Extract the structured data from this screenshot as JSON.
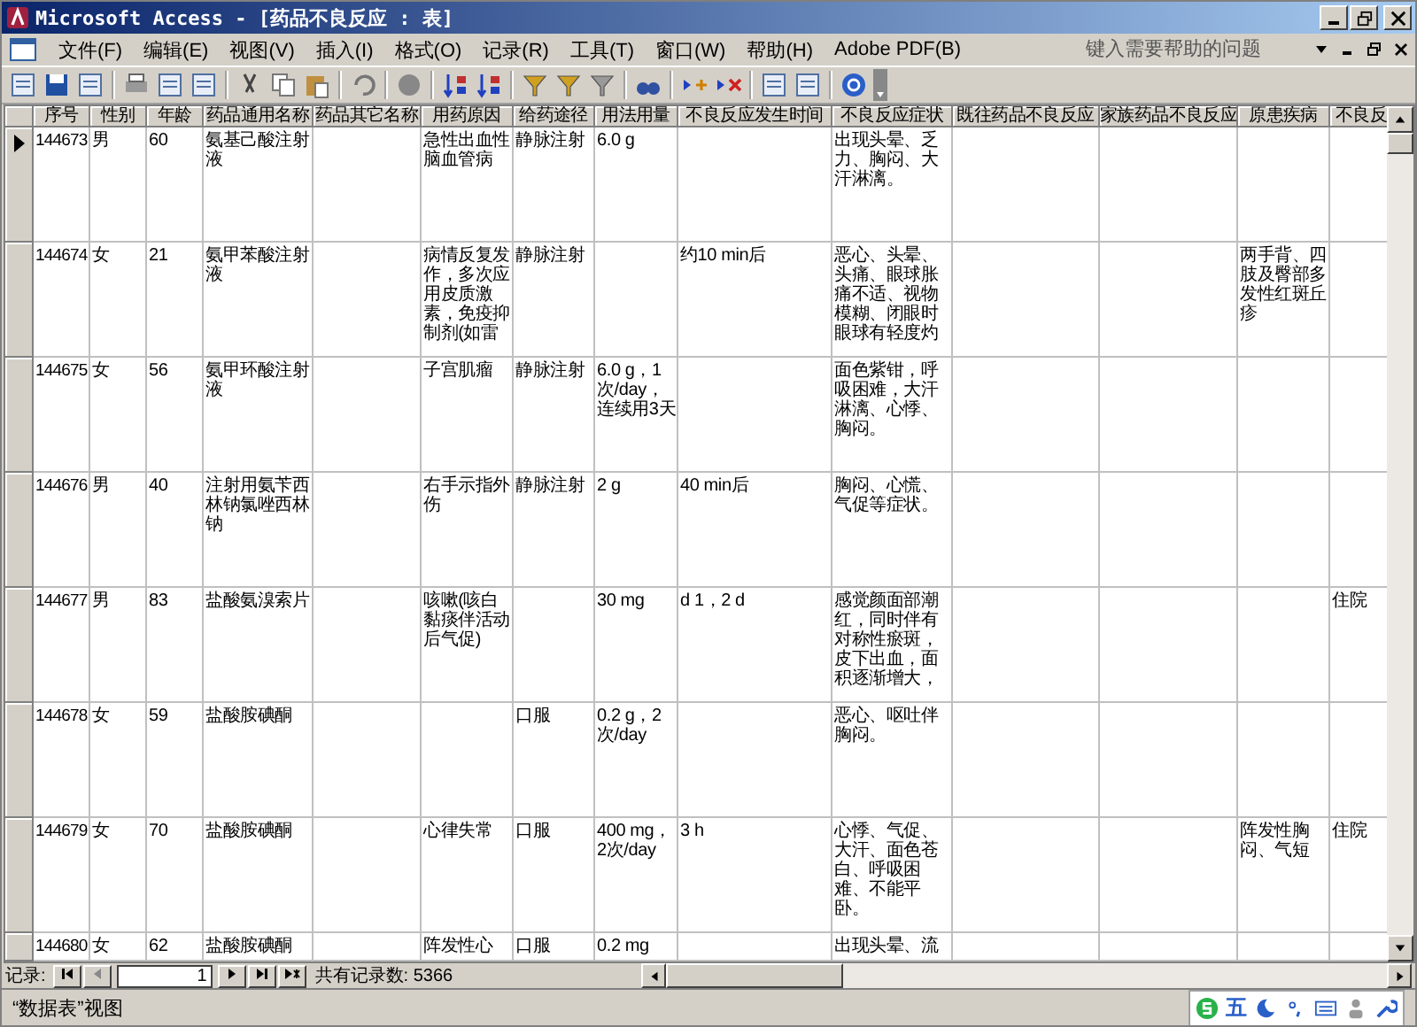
{
  "window": {
    "title": "Microsoft Access - [药品不良反应 : 表]"
  },
  "menu": [
    "文件(F)",
    "编辑(E)",
    "视图(V)",
    "插入(I)",
    "格式(O)",
    "记录(R)",
    "工具(T)",
    "窗口(W)",
    "帮助(H)",
    "Adobe PDF(B)"
  ],
  "help_search": {
    "placeholder": "键入需要帮助的问题"
  },
  "table": {
    "columns": [
      "序号",
      "性别",
      "年龄",
      "药品通用名称",
      "药品其它名称",
      "用药原因",
      "给药途径",
      "用法用量",
      "不良反应发生时间",
      "不良反应症状",
      "既往药品不良反应",
      "家族药品不良反应",
      "原患疾病",
      "不良反"
    ],
    "rows": [
      {
        "selected": true,
        "id": "144673",
        "sex": "男",
        "age": "60",
        "generic_name": "氨基己酸注射液",
        "reason": "急性出血性脑血管病",
        "route": "静脉注射",
        "dosage": "6.0 g",
        "symptoms": "出现头晕、乏力、胸闷、大汗淋漓。"
      },
      {
        "selected": false,
        "id": "144674",
        "sex": "女",
        "age": "21",
        "generic_name": "氨甲苯酸注射液",
        "reason": "病情反复发作，多次应用皮质激素，免疫抑制剂(如雷",
        "route": "静脉注射",
        "onset_time": "约10 min后",
        "symptoms": "恶心、头晕、头痛、眼球胀痛不适、视物模糊、闭眼时眼球有轻度灼",
        "underlying_disease": "两手背、四肢及臀部多发性红斑丘疹"
      },
      {
        "selected": false,
        "id": "144675",
        "sex": "女",
        "age": "56",
        "generic_name": "氨甲环酸注射液",
        "reason": "子宫肌瘤",
        "route": "静脉注射",
        "dosage": "6.0 g，1次/day，连续用3天",
        "symptoms": "面色紫钳，呼吸困难，大汗淋漓、心悸、胸闷。"
      },
      {
        "selected": false,
        "id": "144676",
        "sex": "男",
        "age": "40",
        "generic_name": "注射用氨苄西林钠氯唑西林钠",
        "reason": "右手示指外伤",
        "route": "静脉注射",
        "dosage": "2 g",
        "onset_time": "40 min后",
        "symptoms": "胸闷、心慌、气促等症状。"
      },
      {
        "selected": false,
        "id": "144677",
        "sex": "男",
        "age": "83",
        "generic_name": "盐酸氨溴索片",
        "reason": "咳嗽(咳白黏痰伴活动后气促)",
        "dosage": "30 mg",
        "onset_time": "d 1，2 d",
        "symptoms": "感觉颜面部潮红，同时伴有对称性瘀斑，皮下出血，面积逐渐增大，",
        "column_14": "住院"
      },
      {
        "selected": false,
        "id": "144678",
        "sex": "女",
        "age": "59",
        "generic_name": "盐酸胺碘酮",
        "route": "口服",
        "dosage": "0.2 g，2次/day",
        "symptoms": "恶心、呕吐伴胸闷。"
      },
      {
        "selected": false,
        "id": "144679",
        "sex": "女",
        "age": "70",
        "generic_name": "盐酸胺碘酮",
        "reason": "心律失常",
        "route": "口服",
        "dosage": "400 mg，2次/day",
        "onset_time": "3 h",
        "symptoms": "心悸、气促、大汗、面色苍白、呼吸困难、不能平卧。",
        "underlying_disease": "阵发性胸闷、气短",
        "column_14": "住院"
      },
      {
        "selected": false,
        "id": "144680",
        "sex": "女",
        "age": "62",
        "generic_name": "盐酸胺碘酮",
        "reason": "阵发性心",
        "route": "口服",
        "dosage": "0.2 mg",
        "symptoms": "出现头晕、流"
      }
    ]
  },
  "navigator": {
    "label": "记录:",
    "current": "1",
    "total": "共有记录数: 5366"
  },
  "status_bar": {
    "view": "“数据表”视图",
    "ime_mode": "五"
  }
}
